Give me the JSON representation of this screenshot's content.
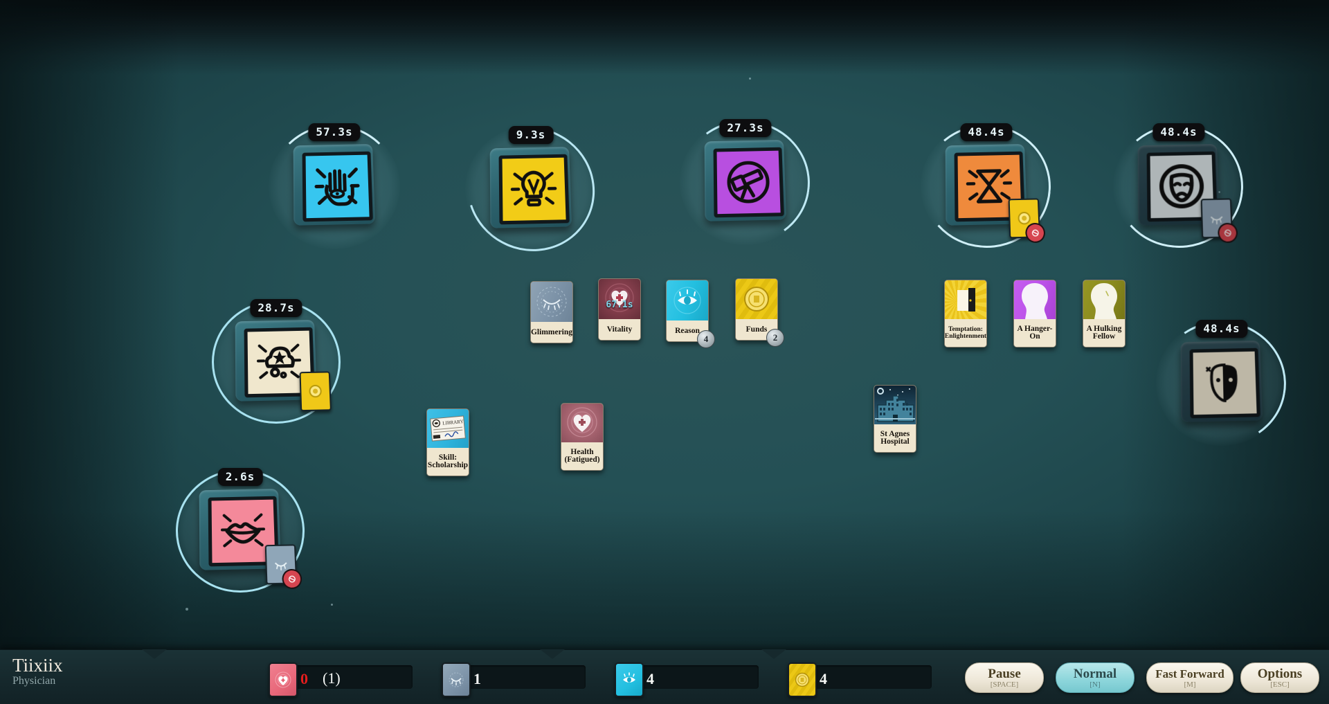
{
  "player": {
    "name": "Tiixiix",
    "role": "Physician"
  },
  "verbs": [
    {
      "id": "work",
      "name": "work-verb",
      "icon": "hand-eye-icon",
      "timer": "57.3s",
      "color": "#37c6ef",
      "progress": "start",
      "dim": false,
      "slot": null
    },
    {
      "id": "study",
      "name": "study-verb",
      "icon": "lightbulb-icon",
      "timer": "9.3s",
      "color": "#f2cc17",
      "progress": "almost",
      "dim": false,
      "slot": null
    },
    {
      "id": "explore",
      "name": "explore-verb",
      "icon": "telescope-icon",
      "timer": "27.3s",
      "color": "#b84fe0",
      "progress": "partial",
      "dim": false,
      "slot": null
    },
    {
      "id": "time",
      "name": "time-verb",
      "icon": "hourglass-icon",
      "timer": "48.4s",
      "color": "#ef8a3c",
      "progress": "mostly",
      "dim": false,
      "slot": {
        "name": "funds-mini-card",
        "color": "#f0c818",
        "icon": "coin-icon",
        "blocked": true
      }
    },
    {
      "id": "dream",
      "name": "dream-verb",
      "icon": "drama-mask-icon",
      "timer": "48.4s",
      "color": "#dfe8ea",
      "progress": "mostly",
      "dim": true,
      "slot": {
        "name": "glimmering-mini-card",
        "color": "#8fa6b8",
        "icon": "eye-closed-icon",
        "blocked": true
      }
    },
    {
      "id": "dreamcloud",
      "name": "dream-cloud-verb",
      "icon": "cloud-star-icon",
      "timer": "28.7s",
      "color": "#f0e7cd",
      "progress": "full",
      "dim": false,
      "slot": {
        "name": "funds-mini-card",
        "color": "#f0c818",
        "icon": "coin-icon",
        "blocked": false
      }
    },
    {
      "id": "talk",
      "name": "talk-verb",
      "icon": "lips-icon",
      "timer": "2.6s",
      "color": "#f4899a",
      "progress": "full",
      "dim": false,
      "slot": {
        "name": "glimmering-mini-card",
        "color": "#8fa6b8",
        "icon": "eye-closed-icon",
        "blocked": true
      }
    },
    {
      "id": "dream2",
      "name": "dream-verb-2",
      "icon": "two-masks-icon",
      "timer": "48.4s",
      "color": "#f2ead5",
      "progress": "partial",
      "dim": true,
      "slot": null
    }
  ],
  "cards": [
    {
      "name": "glimmering-card",
      "label": "Glimmering",
      "art": "#7d93a8",
      "icon": "eye-closed-icon",
      "stack": null,
      "timer": null,
      "two_line": false
    },
    {
      "name": "vitality-card",
      "label": "Vitality",
      "art": "#7e3b48",
      "icon": "heart-cross-icon",
      "stack": null,
      "timer": "67.1s",
      "two_line": false
    },
    {
      "name": "reason-card",
      "label": "Reason",
      "art": "#23bfe0",
      "icon": "eye-open-icon",
      "stack": "4",
      "timer": null,
      "two_line": false
    },
    {
      "name": "funds-card",
      "label": "Funds",
      "art": "#ecc816",
      "icon": "coin-icon",
      "stack": "2",
      "timer": null,
      "two_line": false
    },
    {
      "name": "skill-scholarship-card",
      "label": "Skill:\nScholarship",
      "art": "#2fb4dd",
      "icon": "library-card-icon",
      "stack": null,
      "timer": null,
      "two_line": true
    },
    {
      "name": "health-fatigued-card",
      "label": "Health\n(Fatigued)",
      "art": "#a4626e",
      "icon": "heart-cross-icon",
      "stack": null,
      "timer": null,
      "two_line": true
    },
    {
      "name": "temptation-enlightenment-card",
      "label": "Temptation:\nEnlightenment",
      "art": "#e9c21a",
      "icon": "open-door-icon",
      "stack": null,
      "timer": null,
      "two_line": true
    },
    {
      "name": "hanger-on-card",
      "label": "A Hanger-\nOn",
      "art": "#bb52e8",
      "icon": "head-silhouette-icon",
      "stack": null,
      "timer": null,
      "two_line": true
    },
    {
      "name": "hulking-fellow-card",
      "label": "A Hulking\nFellow",
      "art": "#8a8a1e",
      "icon": "head-silhouette-icon",
      "stack": null,
      "timer": null,
      "two_line": true
    },
    {
      "name": "st-agnes-hospital-card",
      "label": "St Agnes\nHospital",
      "art": "#2b5f7a",
      "icon": "hospital-icon",
      "stack": null,
      "timer": null,
      "two_line": true
    }
  ],
  "status": [
    {
      "name": "health-status",
      "icon": "heart-cross-icon",
      "color": "#e8687a",
      "value": "0",
      "extra": "(1)",
      "value_color": "#e61d1d"
    },
    {
      "name": "glimmering-status",
      "icon": "eye-closed-icon",
      "color": "#7d93a8",
      "value": "1",
      "extra": null,
      "value_color": "#f4f6f4"
    },
    {
      "name": "reason-status",
      "icon": "eye-open-icon",
      "color": "#23bfe0",
      "value": "4",
      "extra": null,
      "value_color": "#f4f6f4"
    },
    {
      "name": "funds-status",
      "icon": "coin-icon",
      "color": "#ecc816",
      "value": "4",
      "extra": null,
      "value_color": "#f4f6f4"
    }
  ],
  "controls": [
    {
      "name": "pause-button",
      "label": "Pause",
      "key": "[SPACE]",
      "active": false
    },
    {
      "name": "normal-speed-button",
      "label": "Normal",
      "key": "[N]",
      "active": true
    },
    {
      "name": "fast-forward-button",
      "label": "Fast Forward",
      "key": "[M]",
      "active": false
    },
    {
      "name": "options-button",
      "label": "Options",
      "key": "[ESC]",
      "active": false
    }
  ]
}
